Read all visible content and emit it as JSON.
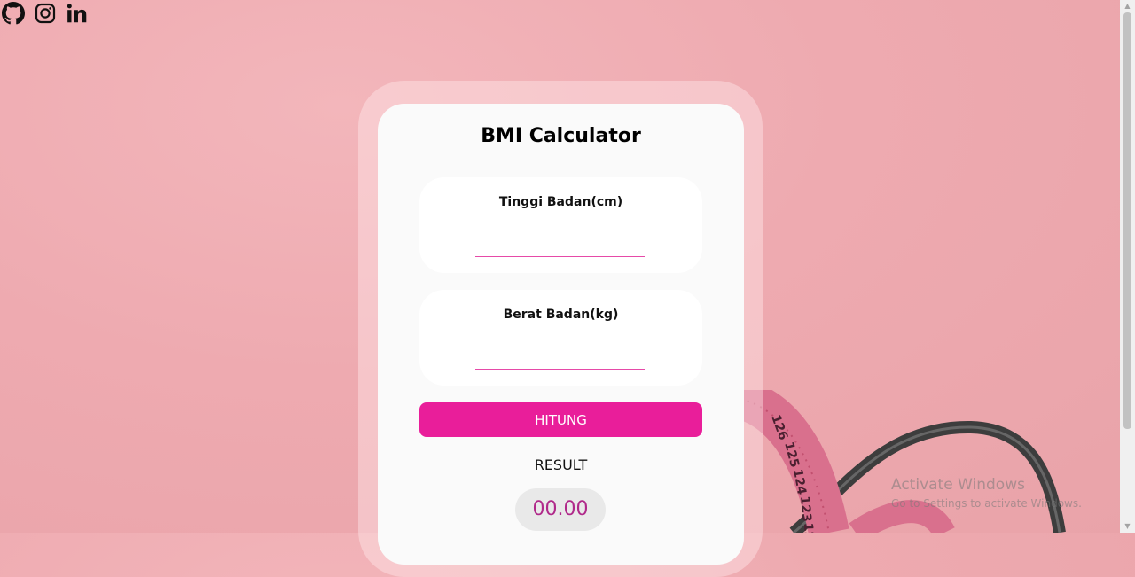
{
  "social": {
    "github_icon": "github-icon",
    "instagram_icon": "instagram-icon",
    "linkedin_icon": "linkedin-icon"
  },
  "calculator": {
    "title": "BMI Calculator",
    "height_field": {
      "label": "Tinggi Badan(cm)",
      "value": "",
      "placeholder": ""
    },
    "weight_field": {
      "label": "Berat Badan(kg)",
      "value": "",
      "placeholder": ""
    },
    "calculate_button": "HITUNG",
    "result_label": "RESULT",
    "result_value": "00.00"
  },
  "watermark": {
    "line1": "Activate Windows",
    "line2": "Go to Settings to activate Windows."
  },
  "colors": {
    "background": "#eeaab0",
    "accent": "#e91e9a",
    "result_text": "#b0298a",
    "card": "#fafafa"
  }
}
